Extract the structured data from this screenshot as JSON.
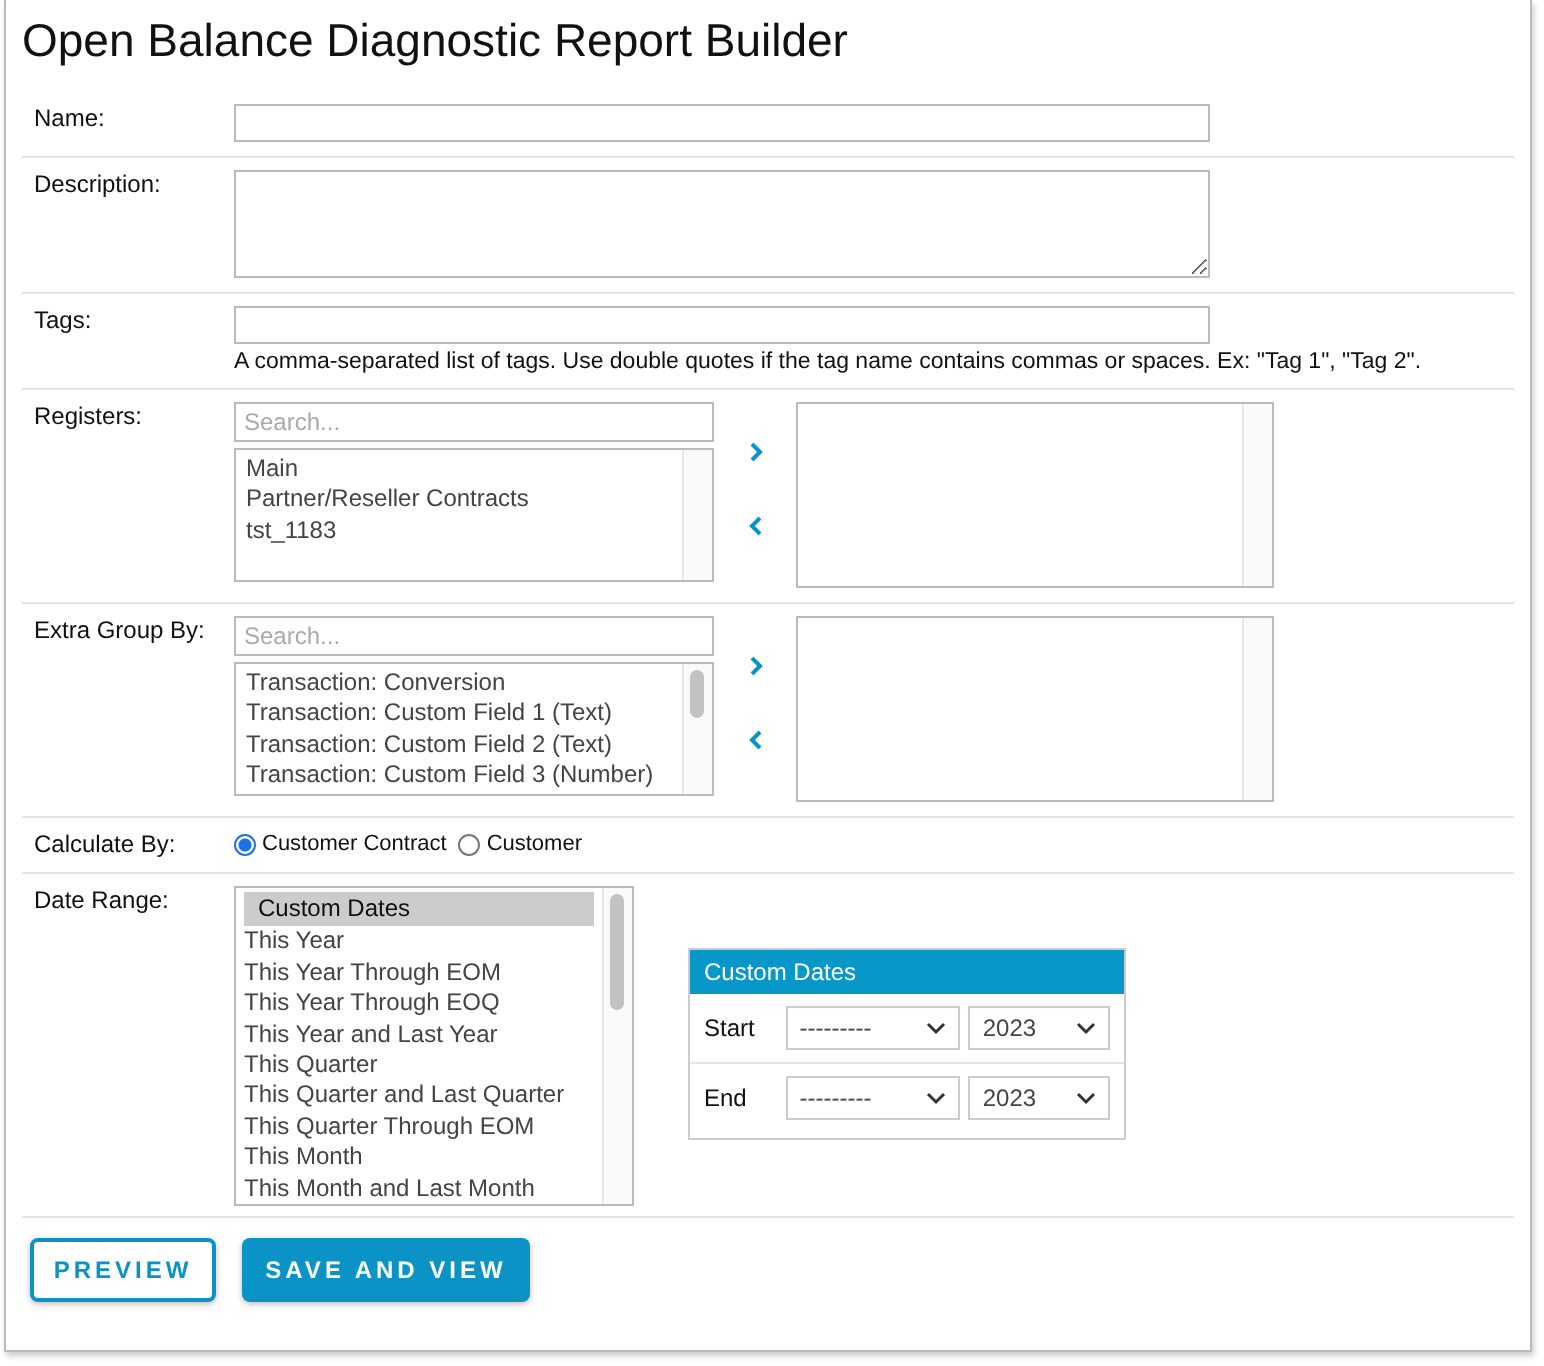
{
  "title": "Open Balance Diagnostic Report Builder",
  "name": {
    "label": "Name:"
  },
  "description": {
    "label": "Description:"
  },
  "tags": {
    "label": "Tags:",
    "help": "A comma-separated list of tags. Use double quotes if the tag name contains commas or spaces. Ex: \"Tag 1\", \"Tag 2\"."
  },
  "registers": {
    "label": "Registers:",
    "search_placeholder": "Search...",
    "available": [
      "Main",
      "Partner/Reseller Contracts",
      "tst_1183"
    ]
  },
  "extra_group_by": {
    "label": "Extra Group By:",
    "search_placeholder": "Search...",
    "available": [
      "Transaction: Conversion",
      "Transaction: Custom Field 1 (Text)",
      "Transaction: Custom Field 2 (Text)",
      "Transaction: Custom Field 3 (Number)"
    ]
  },
  "calculate_by": {
    "label": "Calculate By:",
    "options": [
      {
        "label": "Customer Contract",
        "selected": true
      },
      {
        "label": "Customer",
        "selected": false
      }
    ]
  },
  "date_range": {
    "label": "Date Range:",
    "options": [
      {
        "label": "Custom Dates",
        "selected": true
      },
      {
        "label": "This Year",
        "selected": false
      },
      {
        "label": "This Year Through EOM",
        "selected": false
      },
      {
        "label": "This Year Through EOQ",
        "selected": false
      },
      {
        "label": "This Year and Last Year",
        "selected": false
      },
      {
        "label": "This Quarter",
        "selected": false
      },
      {
        "label": "This Quarter and Last Quarter",
        "selected": false
      },
      {
        "label": "This Quarter Through EOM",
        "selected": false
      },
      {
        "label": "This Month",
        "selected": false
      },
      {
        "label": "This Month and Last Month",
        "selected": false
      }
    ]
  },
  "custom_dates": {
    "title": "Custom Dates",
    "rows": [
      {
        "label": "Start",
        "month": "---------",
        "year": "2023"
      },
      {
        "label": "End",
        "month": "---------",
        "year": "2023"
      }
    ]
  },
  "buttons": [
    {
      "label": "PREVIEW",
      "kind": "outline"
    },
    {
      "label": "SAVE AND VIEW",
      "kind": "primary"
    }
  ]
}
